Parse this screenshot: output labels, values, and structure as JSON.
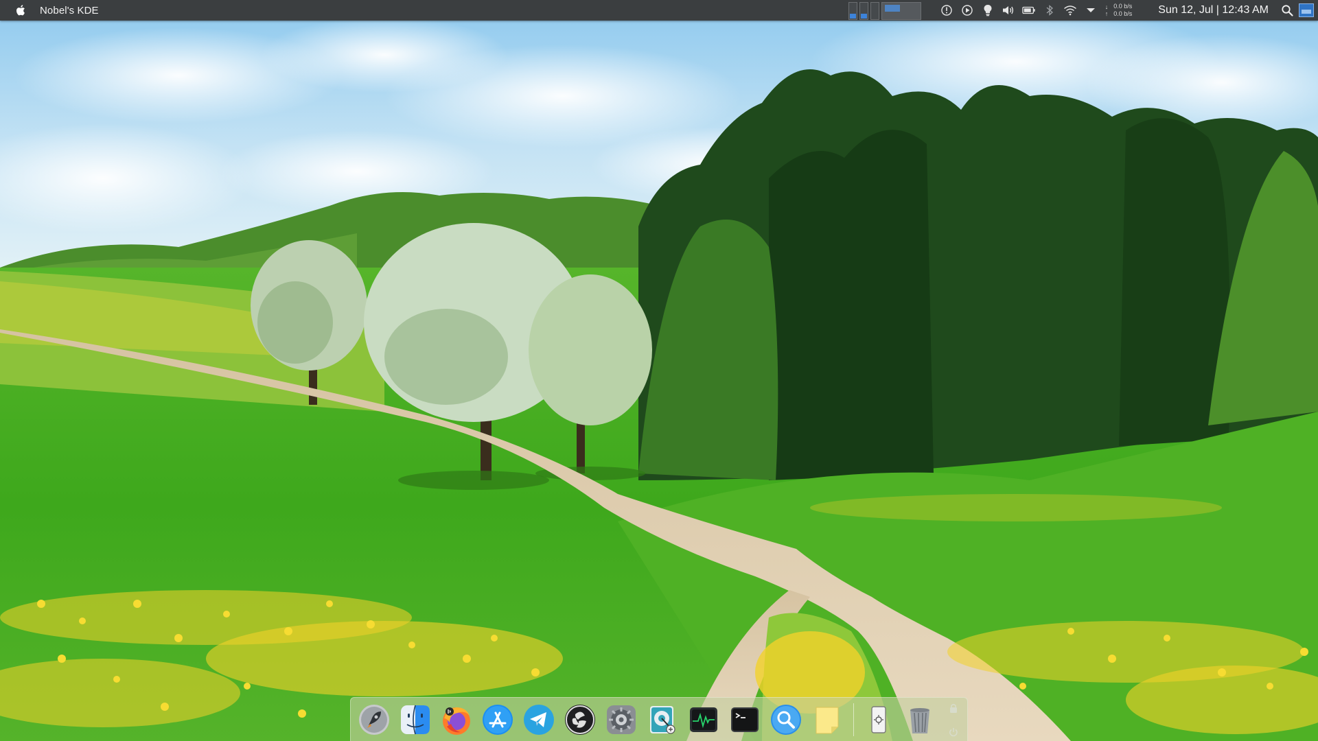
{
  "top_panel": {
    "app_name": "Nobel's KDE",
    "network": {
      "up_arrow": "↓",
      "down_arrow": "↑",
      "down_speed": "0.0 b/s",
      "up_speed": "0.0 b/s"
    },
    "clock": "Sun 12, Jul | 12:43 AM",
    "tray_icons": [
      "info-icon",
      "media-player-icon",
      "lightbulb-icon",
      "volume-icon",
      "battery-icon",
      "bluetooth-icon",
      "wifi-icon",
      "expand-tray-icon"
    ]
  },
  "dock": {
    "items": [
      "launchpad-rocket-icon",
      "finder-icon",
      "firefox-icon",
      "app-store-icon",
      "telegram-icon",
      "obs-studio-icon",
      "system-settings-icon",
      "disk-utility-icon",
      "activity-monitor-icon",
      "terminal-icon",
      "search-app-icon",
      "notes-icon",
      "screenshot-tool-icon",
      "trash-icon"
    ]
  },
  "colors": {
    "panel_bg": "#3b3e40",
    "accent_blue": "#3d83d9",
    "dock_tint": "#c4cea0"
  }
}
